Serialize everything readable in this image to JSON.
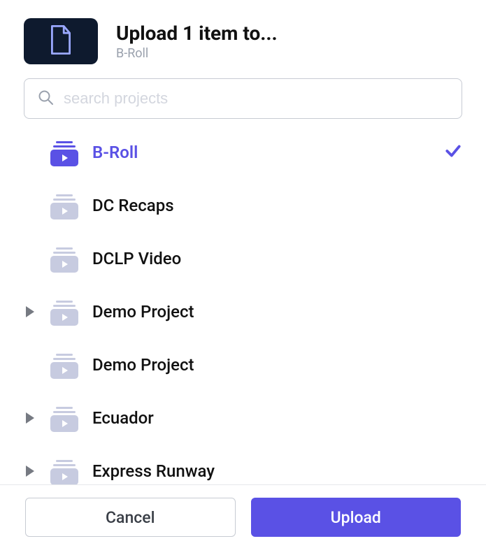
{
  "header": {
    "title": "Upload 1 item to...",
    "subtitle": "B-Roll"
  },
  "search": {
    "placeholder": "search projects",
    "value": ""
  },
  "projects": [
    {
      "label": "B-Roll",
      "expandable": false,
      "selected": true
    },
    {
      "label": "DC Recaps",
      "expandable": false,
      "selected": false
    },
    {
      "label": "DCLP Video",
      "expandable": false,
      "selected": false
    },
    {
      "label": "Demo Project",
      "expandable": true,
      "selected": false
    },
    {
      "label": "Demo Project",
      "expandable": false,
      "selected": false
    },
    {
      "label": "Ecuador",
      "expandable": true,
      "selected": false
    },
    {
      "label": "Express Runway",
      "expandable": true,
      "selected": false
    }
  ],
  "footer": {
    "cancel": "Cancel",
    "upload": "Upload"
  },
  "colors": {
    "accent": "#5a51e5",
    "muted_icon": "#c7cbe0",
    "thumb_bg": "#0e1a2e",
    "thumb_stroke": "#9aa8ff"
  }
}
